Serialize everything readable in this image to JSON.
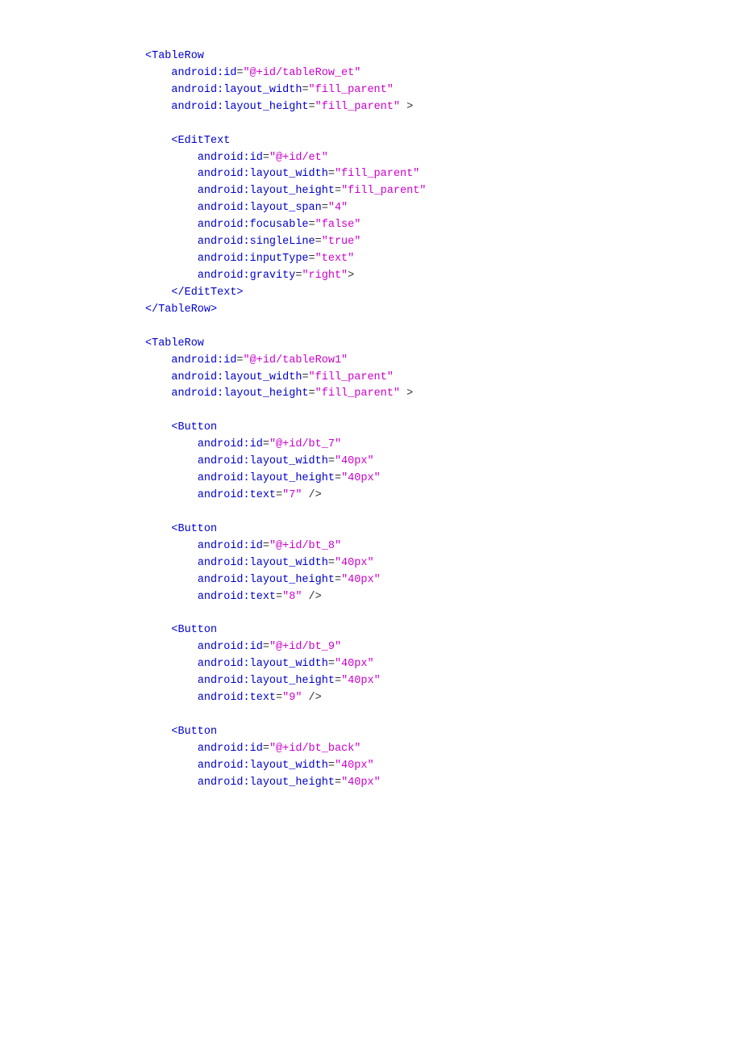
{
  "colors": {
    "tag": "#0000cc",
    "attr_name": "#0000cc",
    "attr_value": "#cc00cc",
    "punct": "#333333",
    "background": "#ffffff"
  },
  "code": {
    "blocks": [
      {
        "id": "tablerow-et-open",
        "lines": [
          {
            "indent": 0,
            "parts": [
              {
                "type": "tag",
                "text": "<TableRow"
              }
            ]
          },
          {
            "indent": 1,
            "parts": [
              {
                "type": "attr-name",
                "text": "android:id"
              },
              {
                "type": "punct",
                "text": "="
              },
              {
                "type": "attr-value",
                "text": "\"@+id/tableRow_et\""
              }
            ]
          },
          {
            "indent": 1,
            "parts": [
              {
                "type": "attr-name",
                "text": "android:layout_width"
              },
              {
                "type": "punct",
                "text": "="
              },
              {
                "type": "attr-value",
                "text": "\"fill_parent\""
              }
            ]
          },
          {
            "indent": 1,
            "parts": [
              {
                "type": "attr-name",
                "text": "android:layout_height"
              },
              {
                "type": "punct",
                "text": "="
              },
              {
                "type": "attr-value",
                "text": "\"fill_parent\""
              },
              {
                "type": "punct",
                "text": " >"
              }
            ]
          }
        ]
      },
      {
        "id": "blank1",
        "lines": [
          {
            "indent": 0,
            "parts": [
              {
                "type": "empty",
                "text": " "
              }
            ]
          }
        ]
      },
      {
        "id": "edittext-block",
        "lines": [
          {
            "indent": 1,
            "parts": [
              {
                "type": "tag",
                "text": "<EditText"
              }
            ]
          },
          {
            "indent": 2,
            "parts": [
              {
                "type": "attr-name",
                "text": "android:id"
              },
              {
                "type": "punct",
                "text": "="
              },
              {
                "type": "attr-value",
                "text": "\"@+id/et\""
              }
            ]
          },
          {
            "indent": 2,
            "parts": [
              {
                "type": "attr-name",
                "text": "android:layout_width"
              },
              {
                "type": "punct",
                "text": "="
              },
              {
                "type": "attr-value",
                "text": "\"fill_parent\""
              }
            ]
          },
          {
            "indent": 2,
            "parts": [
              {
                "type": "attr-name",
                "text": "android:layout_height"
              },
              {
                "type": "punct",
                "text": "="
              },
              {
                "type": "attr-value",
                "text": "\"fill_parent\""
              }
            ]
          },
          {
            "indent": 2,
            "parts": [
              {
                "type": "attr-name",
                "text": "android:layout_span"
              },
              {
                "type": "punct",
                "text": "="
              },
              {
                "type": "attr-value",
                "text": "\"4\""
              }
            ]
          },
          {
            "indent": 2,
            "parts": [
              {
                "type": "attr-name",
                "text": "android:focusable"
              },
              {
                "type": "punct",
                "text": "="
              },
              {
                "type": "attr-value",
                "text": "\"false\""
              }
            ]
          },
          {
            "indent": 2,
            "parts": [
              {
                "type": "attr-name",
                "text": "android:singleLine"
              },
              {
                "type": "punct",
                "text": "="
              },
              {
                "type": "attr-value",
                "text": "\"true\""
              }
            ]
          },
          {
            "indent": 2,
            "parts": [
              {
                "type": "attr-name",
                "text": "android:inputType"
              },
              {
                "type": "punct",
                "text": "="
              },
              {
                "type": "attr-value",
                "text": "\"text\""
              }
            ]
          },
          {
            "indent": 2,
            "parts": [
              {
                "type": "attr-name",
                "text": "android:gravity"
              },
              {
                "type": "punct",
                "text": "="
              },
              {
                "type": "attr-value",
                "text": "\"right\""
              },
              {
                "type": "punct",
                "text": ">"
              }
            ]
          },
          {
            "indent": 1,
            "parts": [
              {
                "type": "tag",
                "text": "</EditText>"
              }
            ]
          }
        ]
      },
      {
        "id": "tablerow-et-close",
        "lines": [
          {
            "indent": 0,
            "parts": [
              {
                "type": "tag",
                "text": "</TableRow>"
              }
            ]
          }
        ]
      },
      {
        "id": "blank2",
        "lines": [
          {
            "indent": 0,
            "parts": [
              {
                "type": "empty",
                "text": " "
              }
            ]
          }
        ]
      },
      {
        "id": "tablerow-row1-open",
        "lines": [
          {
            "indent": 0,
            "parts": [
              {
                "type": "tag",
                "text": "<TableRow"
              }
            ]
          },
          {
            "indent": 1,
            "parts": [
              {
                "type": "attr-name",
                "text": "android:id"
              },
              {
                "type": "punct",
                "text": "="
              },
              {
                "type": "attr-value",
                "text": "\"@+id/tableRow1\""
              }
            ]
          },
          {
            "indent": 1,
            "parts": [
              {
                "type": "attr-name",
                "text": "android:layout_width"
              },
              {
                "type": "punct",
                "text": "="
              },
              {
                "type": "attr-value",
                "text": "\"fill_parent\""
              }
            ]
          },
          {
            "indent": 1,
            "parts": [
              {
                "type": "attr-name",
                "text": "android:layout_height"
              },
              {
                "type": "punct",
                "text": "="
              },
              {
                "type": "attr-value",
                "text": "\"fill_parent\""
              },
              {
                "type": "punct",
                "text": " >"
              }
            ]
          }
        ]
      },
      {
        "id": "blank3",
        "lines": [
          {
            "indent": 0,
            "parts": [
              {
                "type": "empty",
                "text": " "
              }
            ]
          }
        ]
      },
      {
        "id": "button-7",
        "lines": [
          {
            "indent": 1,
            "parts": [
              {
                "type": "tag",
                "text": "<Button"
              }
            ]
          },
          {
            "indent": 2,
            "parts": [
              {
                "type": "attr-name",
                "text": "android:id"
              },
              {
                "type": "punct",
                "text": "="
              },
              {
                "type": "attr-value",
                "text": "\"@+id/bt_7\""
              }
            ]
          },
          {
            "indent": 2,
            "parts": [
              {
                "type": "attr-name",
                "text": "android:layout_width"
              },
              {
                "type": "punct",
                "text": "="
              },
              {
                "type": "attr-value",
                "text": "\"40px\""
              }
            ]
          },
          {
            "indent": 2,
            "parts": [
              {
                "type": "attr-name",
                "text": "android:layout_height"
              },
              {
                "type": "punct",
                "text": "="
              },
              {
                "type": "attr-value",
                "text": "\"40px\""
              }
            ]
          },
          {
            "indent": 2,
            "parts": [
              {
                "type": "attr-name",
                "text": "android:text"
              },
              {
                "type": "punct",
                "text": "="
              },
              {
                "type": "attr-value",
                "text": "\"7\""
              },
              {
                "type": "punct",
                "text": " />"
              }
            ]
          }
        ]
      },
      {
        "id": "blank4",
        "lines": [
          {
            "indent": 0,
            "parts": [
              {
                "type": "empty",
                "text": " "
              }
            ]
          }
        ]
      },
      {
        "id": "button-8",
        "lines": [
          {
            "indent": 1,
            "parts": [
              {
                "type": "tag",
                "text": "<Button"
              }
            ]
          },
          {
            "indent": 2,
            "parts": [
              {
                "type": "attr-name",
                "text": "android:id"
              },
              {
                "type": "punct",
                "text": "="
              },
              {
                "type": "attr-value",
                "text": "\"@+id/bt_8\""
              }
            ]
          },
          {
            "indent": 2,
            "parts": [
              {
                "type": "attr-name",
                "text": "android:layout_width"
              },
              {
                "type": "punct",
                "text": "="
              },
              {
                "type": "attr-value",
                "text": "\"40px\""
              }
            ]
          },
          {
            "indent": 2,
            "parts": [
              {
                "type": "attr-name",
                "text": "android:layout_height"
              },
              {
                "type": "punct",
                "text": "="
              },
              {
                "type": "attr-value",
                "text": "\"40px\""
              }
            ]
          },
          {
            "indent": 2,
            "parts": [
              {
                "type": "attr-name",
                "text": "android:text"
              },
              {
                "type": "punct",
                "text": "="
              },
              {
                "type": "attr-value",
                "text": "\"8\""
              },
              {
                "type": "punct",
                "text": " />"
              }
            ]
          }
        ]
      },
      {
        "id": "blank5",
        "lines": [
          {
            "indent": 0,
            "parts": [
              {
                "type": "empty",
                "text": " "
              }
            ]
          }
        ]
      },
      {
        "id": "button-9",
        "lines": [
          {
            "indent": 1,
            "parts": [
              {
                "type": "tag",
                "text": "<Button"
              }
            ]
          },
          {
            "indent": 2,
            "parts": [
              {
                "type": "attr-name",
                "text": "android:id"
              },
              {
                "type": "punct",
                "text": "="
              },
              {
                "type": "attr-value",
                "text": "\"@+id/bt_9\""
              }
            ]
          },
          {
            "indent": 2,
            "parts": [
              {
                "type": "attr-name",
                "text": "android:layout_width"
              },
              {
                "type": "punct",
                "text": "="
              },
              {
                "type": "attr-value",
                "text": "\"40px\""
              }
            ]
          },
          {
            "indent": 2,
            "parts": [
              {
                "type": "attr-name",
                "text": "android:layout_height"
              },
              {
                "type": "punct",
                "text": "="
              },
              {
                "type": "attr-value",
                "text": "\"40px\""
              }
            ]
          },
          {
            "indent": 2,
            "parts": [
              {
                "type": "attr-name",
                "text": "android:text"
              },
              {
                "type": "punct",
                "text": "="
              },
              {
                "type": "attr-value",
                "text": "\"9\""
              },
              {
                "type": "punct",
                "text": " />"
              }
            ]
          }
        ]
      },
      {
        "id": "blank6",
        "lines": [
          {
            "indent": 0,
            "parts": [
              {
                "type": "empty",
                "text": " "
              }
            ]
          }
        ]
      },
      {
        "id": "button-back",
        "lines": [
          {
            "indent": 1,
            "parts": [
              {
                "type": "tag",
                "text": "<Button"
              }
            ]
          },
          {
            "indent": 2,
            "parts": [
              {
                "type": "attr-name",
                "text": "android:id"
              },
              {
                "type": "punct",
                "text": "="
              },
              {
                "type": "attr-value",
                "text": "\"@+id/bt_back\""
              }
            ]
          },
          {
            "indent": 2,
            "parts": [
              {
                "type": "attr-name",
                "text": "android:layout_width"
              },
              {
                "type": "punct",
                "text": "="
              },
              {
                "type": "attr-value",
                "text": "\"40px\""
              }
            ]
          },
          {
            "indent": 2,
            "parts": [
              {
                "type": "attr-name",
                "text": "android:layout_height"
              },
              {
                "type": "punct",
                "text": "="
              },
              {
                "type": "attr-value",
                "text": "\"40px\""
              }
            ]
          }
        ]
      }
    ]
  }
}
